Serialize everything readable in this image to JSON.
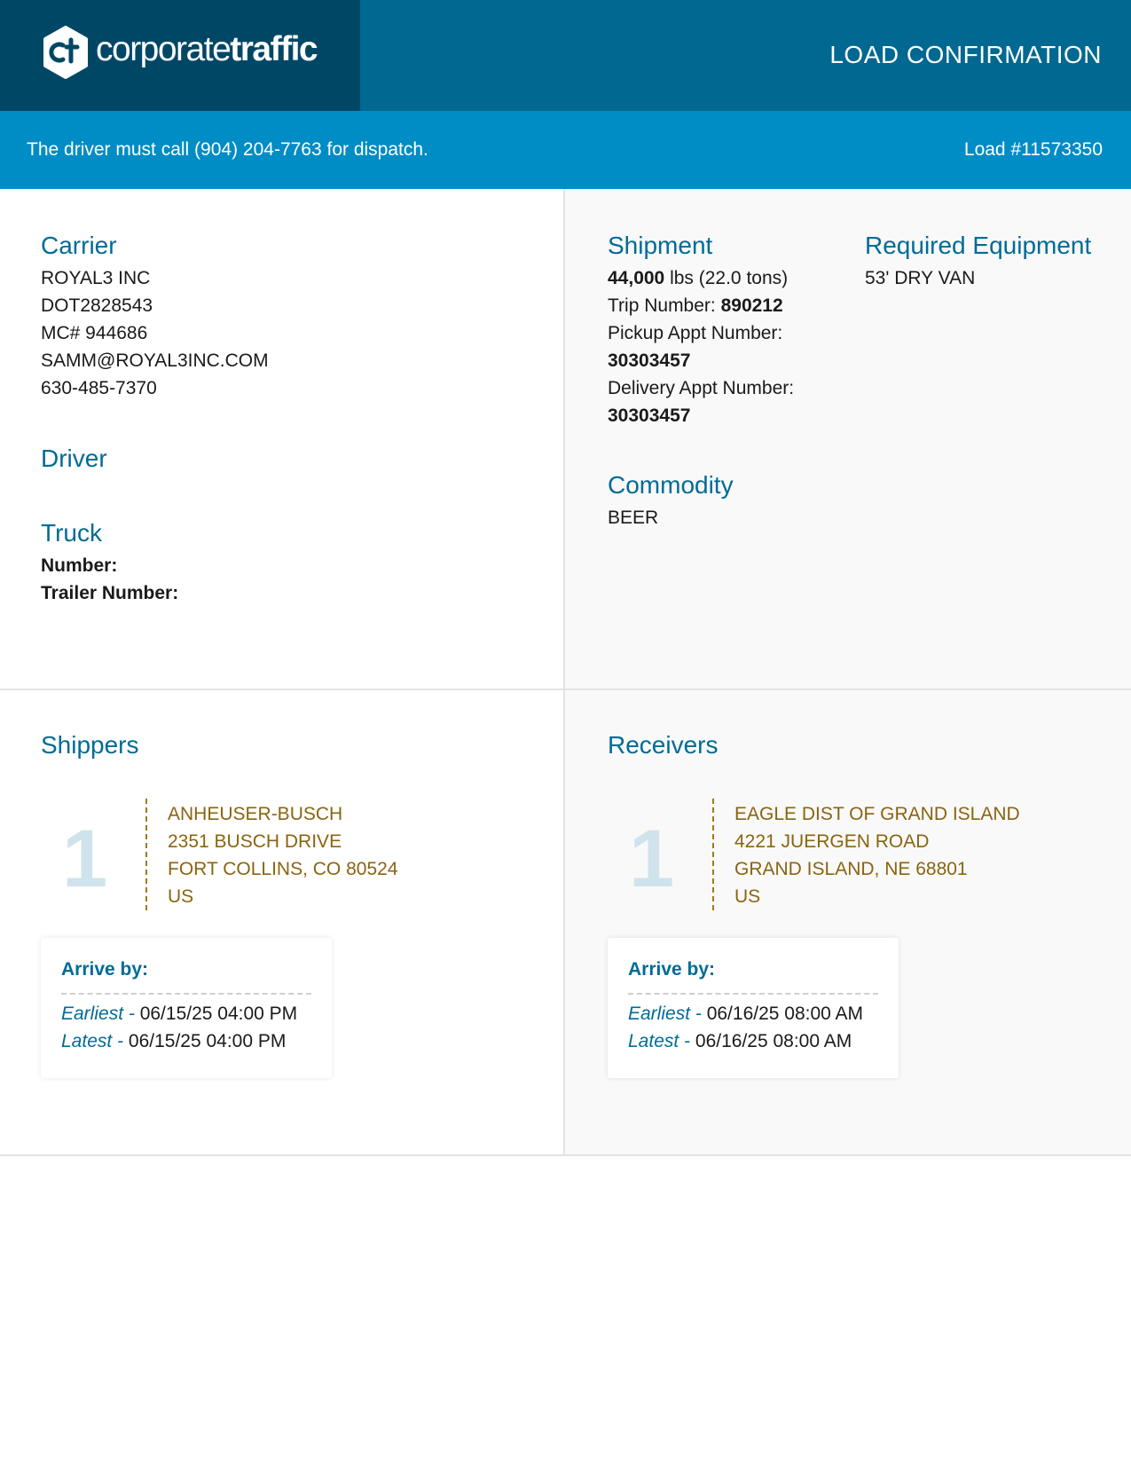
{
  "header": {
    "logo_light": "corporate",
    "logo_bold": "traffic",
    "title": "LOAD CONFIRMATION"
  },
  "banner": {
    "message": "The driver must call (904) 204-7763 for dispatch.",
    "load": "Load #11573350"
  },
  "carrier": {
    "heading": "Carrier",
    "name": "ROYAL3 INC",
    "dot": "DOT2828543",
    "mc": "MC# 944686",
    "email": "SAMM@ROYAL3INC.COM",
    "phone": "630-485-7370"
  },
  "driver": {
    "heading": "Driver"
  },
  "truck": {
    "heading": "Truck",
    "number_label": "Number:",
    "trailer_label": "Trailer Number:"
  },
  "shipment": {
    "heading": "Shipment",
    "weight_value": "44,000",
    "weight_rest": " lbs (22.0 tons)",
    "trip_label": "Trip Number: ",
    "trip_value": "890212",
    "pickup_label": "Pickup Appt Number:",
    "pickup_value": "30303457",
    "delivery_label": "Delivery Appt Number:",
    "delivery_value": "30303457"
  },
  "equipment": {
    "heading": "Required Equipment",
    "value": "53' DRY VAN"
  },
  "commodity": {
    "heading": "Commodity",
    "value": "BEER"
  },
  "shippers": {
    "heading": "Shippers",
    "stops": [
      {
        "number": "1",
        "name": "ANHEUSER-BUSCH",
        "street": "2351 BUSCH DRIVE",
        "city": "FORT COLLINS, CO 80524",
        "country": "US",
        "arrive_label": "Arrive by:",
        "earliest_label": "Earliest -",
        "earliest_value": "06/15/25 04:00 PM",
        "latest_label": "Latest -",
        "latest_value": "06/15/25 04:00 PM"
      }
    ]
  },
  "receivers": {
    "heading": "Receivers",
    "stops": [
      {
        "number": "1",
        "name": "EAGLE DIST OF GRAND ISLAND",
        "street": "4221 JUERGEN ROAD",
        "city": "GRAND ISLAND, NE 68801",
        "country": "US",
        "arrive_label": "Arrive by:",
        "earliest_label": "Earliest -",
        "earliest_value": "06/16/25 08:00 AM",
        "latest_label": "Latest -",
        "latest_value": "06/16/25 08:00 AM"
      }
    ]
  }
}
